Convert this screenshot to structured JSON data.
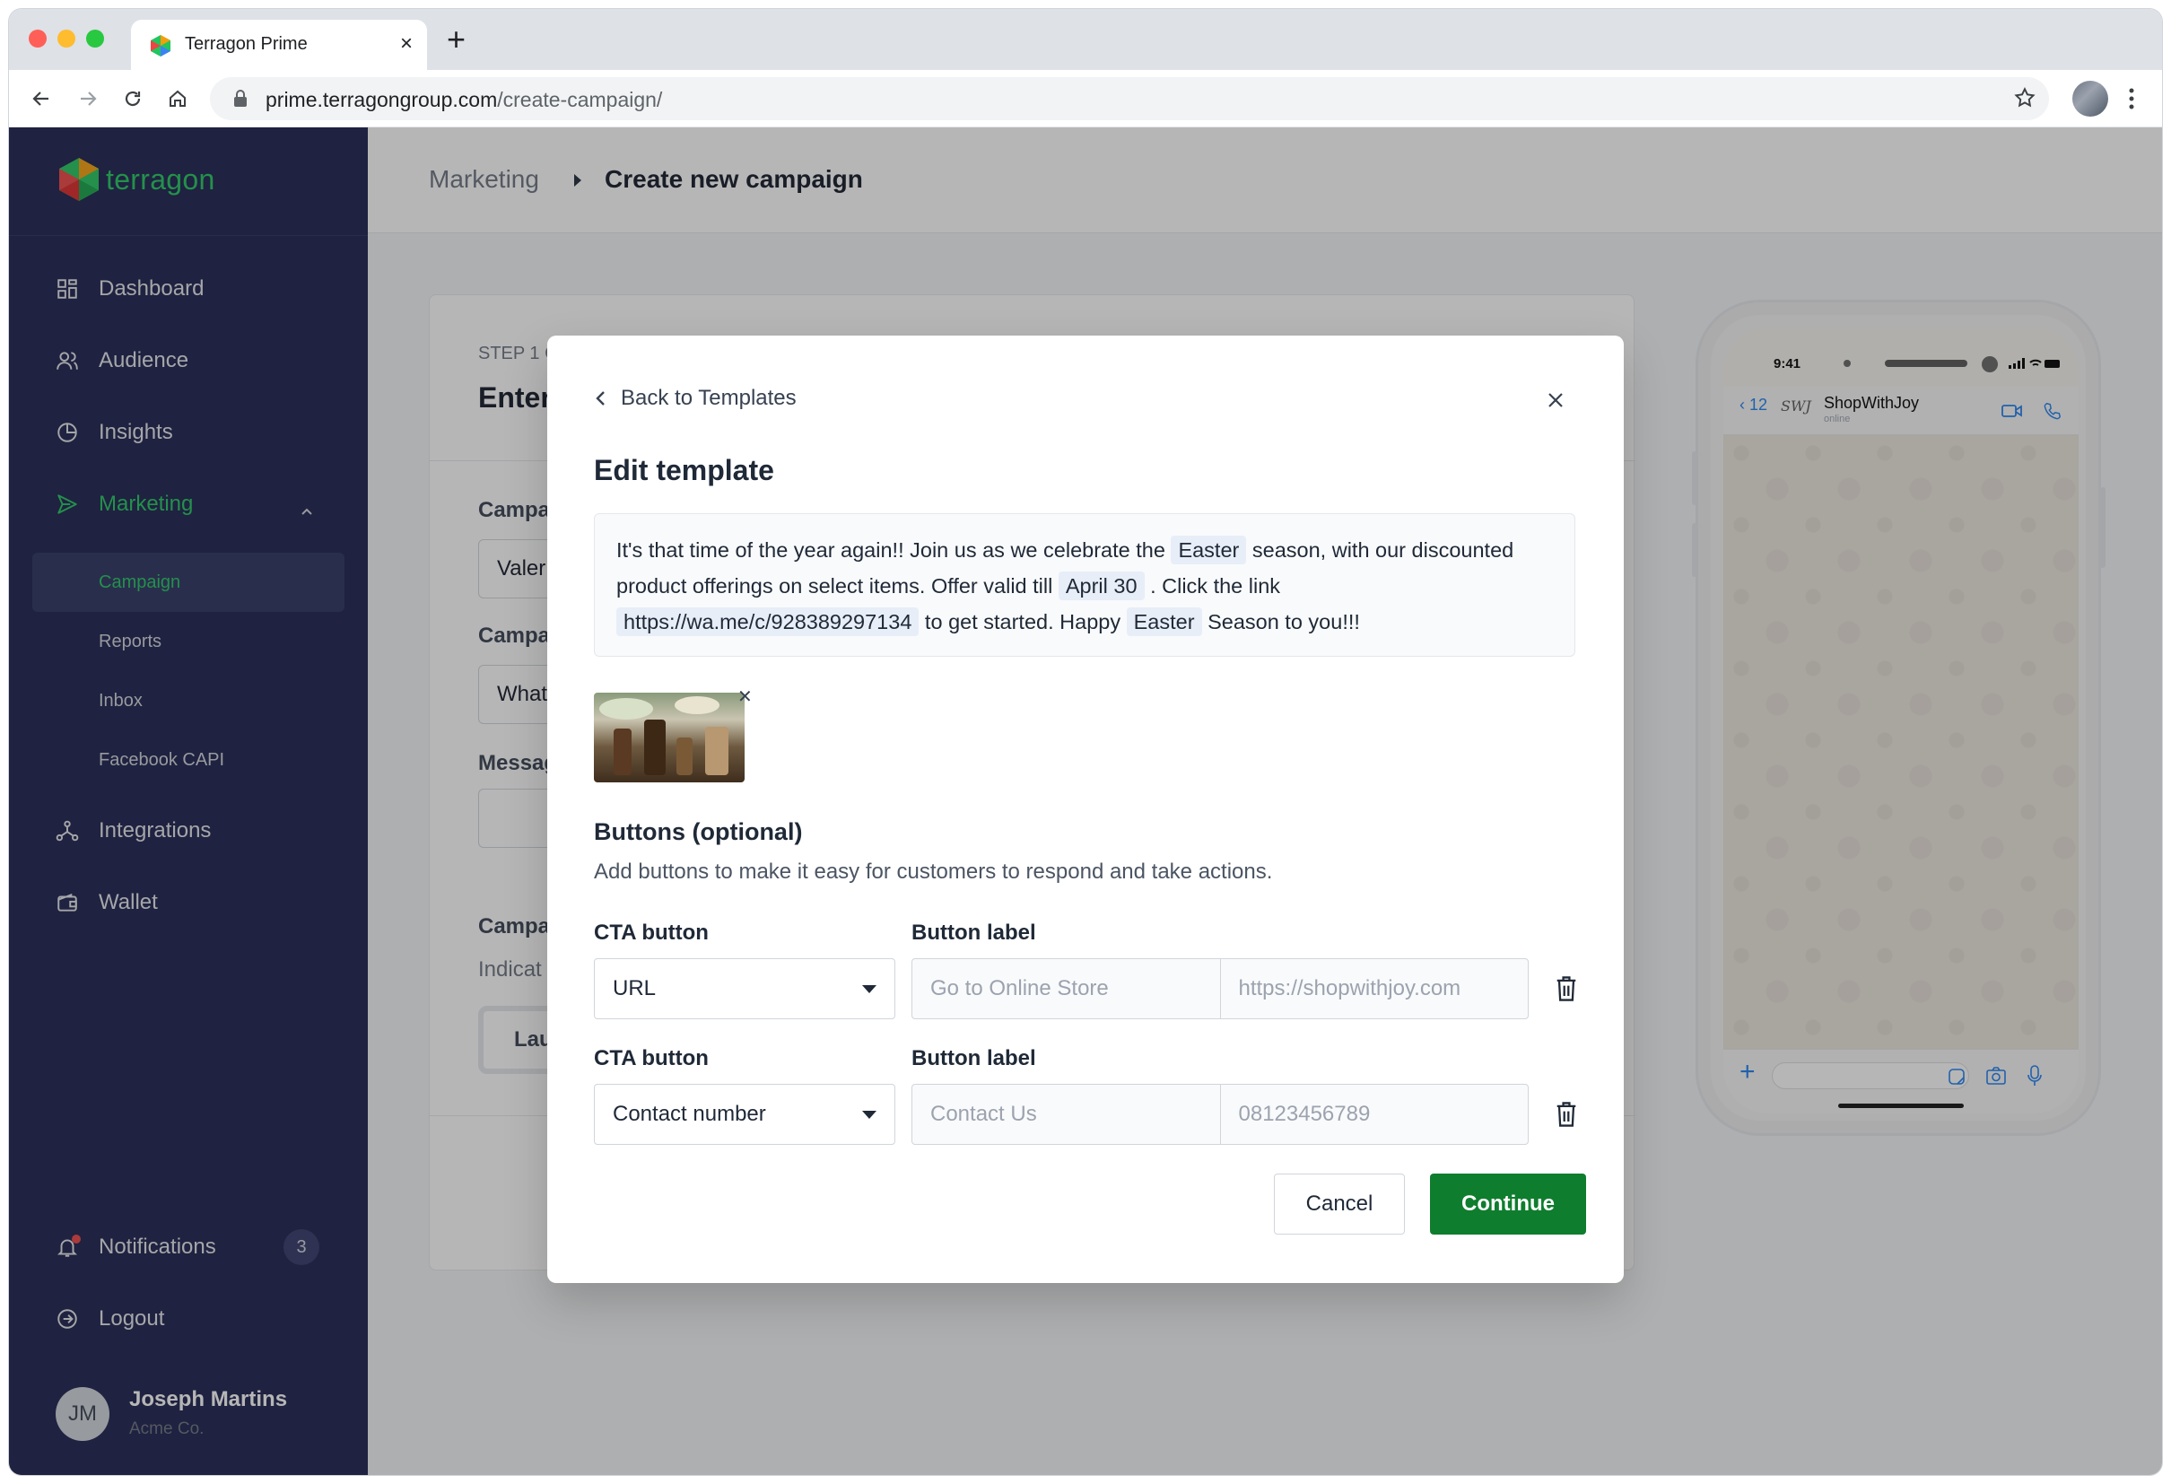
{
  "browser": {
    "tab_title": "Terragon Prime",
    "url_host": "prime.terragongroup.com",
    "url_path": "/create-campaign/"
  },
  "brand": {
    "name": "terragon",
    "accent": "#22c55e",
    "sidebar_bg": "#1a1f4c",
    "primary": "#0f7d2e"
  },
  "sidebar": {
    "items": [
      {
        "label": "Dashboard",
        "icon": "grid-icon"
      },
      {
        "label": "Audience",
        "icon": "users-icon"
      },
      {
        "label": "Insights",
        "icon": "pie-chart-icon"
      },
      {
        "label": "Marketing",
        "icon": "send-icon",
        "active": true
      }
    ],
    "sub_items": [
      {
        "label": "Campaign",
        "active": true
      },
      {
        "label": "Reports"
      },
      {
        "label": "Inbox"
      },
      {
        "label": "Facebook CAPI"
      }
    ],
    "items_lower": [
      {
        "label": "Integrations",
        "icon": "network-icon"
      },
      {
        "label": "Wallet",
        "icon": "wallet-icon"
      }
    ],
    "notifications": {
      "label": "Notifications",
      "count": "3"
    },
    "logout": "Logout",
    "user": {
      "initials": "JM",
      "name": "Joseph Martins",
      "org": "Acme Co."
    }
  },
  "breadcrumb": {
    "parent": "Marketing",
    "current": "Create new campaign"
  },
  "background_form": {
    "step": "STEP 1 C",
    "title": "Enter",
    "label_1": "Campa",
    "value_1": "Valer",
    "label_2": "Campa",
    "value_2": "What",
    "label_3": "Messag",
    "label_4": "Campa",
    "hint": "Indicat",
    "button": "Lau"
  },
  "phone": {
    "time": "9:41",
    "back_count": "12",
    "contact_initials": "SWJ",
    "contact_name": "ShopWithJoy",
    "contact_status": "online"
  },
  "modal": {
    "back_label": "Back to Templates",
    "title": "Edit template",
    "message": {
      "t1": "It's that time of the year again!! Join us as we celebrate the ",
      "v1": "Easter",
      "t2": " season, with our discounted product offerings on select items. Offer valid till ",
      "v2": "April 30",
      "t3": " . Click the link ",
      "v3": "https://wa.me/c/928389297134",
      "t4": " to get started. Happy ",
      "v4": "Easter",
      "t5": " Season to you!!!"
    },
    "buttons_heading": "Buttons (optional)",
    "buttons_subtext": "Add buttons to make it easy for customers to respond and take actions.",
    "rows": [
      {
        "cta_label": "CTA button",
        "label_label": "Button label",
        "cta_value": "URL",
        "label_placeholder": "Go to Online Store",
        "value_placeholder": "https://shopwithjoy.com"
      },
      {
        "cta_label": "CTA button",
        "label_label": "Button label",
        "cta_value": "Contact number",
        "label_placeholder": "Contact Us",
        "value_placeholder": "08123456789"
      }
    ],
    "cancel": "Cancel",
    "continue": "Continue"
  }
}
